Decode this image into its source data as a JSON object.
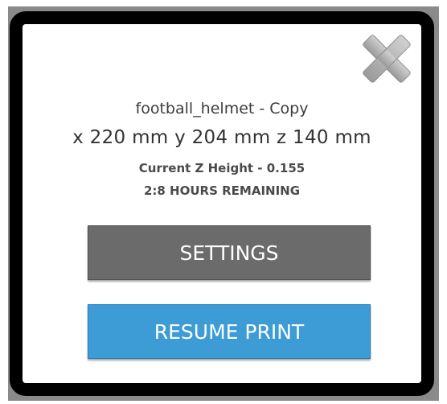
{
  "print_job": {
    "file_name": "football_helmet - Copy",
    "dimensions": "x 220 mm y 204 mm z 140 mm",
    "z_height": "Current Z Height - 0.155",
    "time_remaining": "2:8 HOURS REMAINING"
  },
  "buttons": {
    "settings_label": "SETTINGS",
    "resume_label": "RESUME PRINT"
  },
  "icons": {
    "close": "close-icon"
  },
  "colors": {
    "settings_button": "#6b6b6b",
    "resume_button": "#3d9bd6",
    "dialog_border": "#000000",
    "background": "#8a8a8a"
  }
}
